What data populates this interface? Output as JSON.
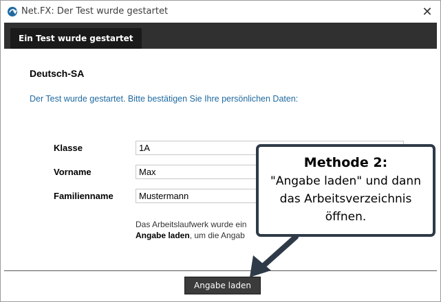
{
  "window": {
    "title": "Net.FX: Der Test wurde gestartet",
    "app_icon": "netfx-logo-icon",
    "close_icon": "close-icon"
  },
  "tabbar": {
    "active_tab": "Ein Test wurde gestartet"
  },
  "form": {
    "section_title": "Deutsch-SA",
    "intro": "Der Test wurde gestartet. Bitte bestätigen Sie Ihre persönlichen Daten:",
    "fields": [
      {
        "label": "Klasse",
        "value": "1A"
      },
      {
        "label": "Vorname",
        "value": "Max"
      },
      {
        "label": "Familienname",
        "value": "Mustermann"
      }
    ],
    "note_line1": "Das Arbeitslaufwerk wurde ein",
    "note_bold": "Angabe laden",
    "note_line2": ", um die Angab"
  },
  "footer": {
    "load_button": "Angabe laden"
  },
  "callout": {
    "title": "Methode 2:",
    "line1": "\"Angabe laden\" und dann",
    "line2": "das Arbeitsverzeichnis",
    "line3": "öffnen."
  },
  "colors": {
    "tabbar": "#303030",
    "tab": "#1a1a1a",
    "intro_text": "#1f6aa0",
    "callout_border": "#2e3a47",
    "button": "#3b3b3b"
  }
}
